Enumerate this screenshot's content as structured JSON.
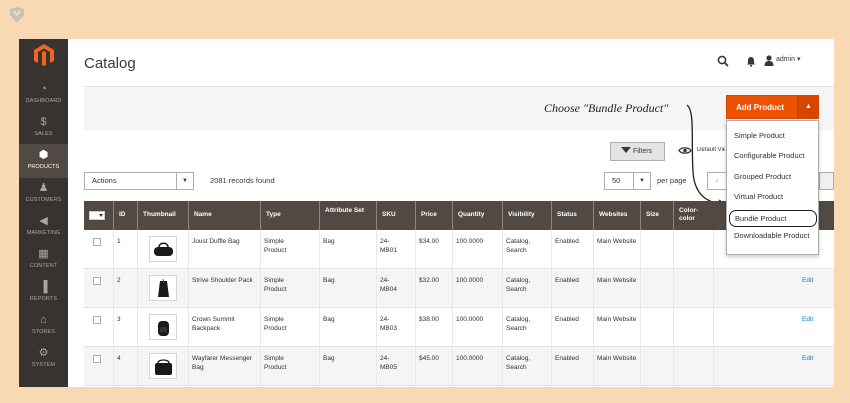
{
  "sidebar": {
    "items": [
      {
        "label": "DASHBOARD",
        "icon": "gauge-icon",
        "glyph": "◔"
      },
      {
        "label": "SALES",
        "icon": "dollar-icon",
        "glyph": "$"
      },
      {
        "label": "PRODUCTS",
        "icon": "cube-icon",
        "glyph": "⬢",
        "active": true
      },
      {
        "label": "CUSTOMERS",
        "icon": "person-icon",
        "glyph": "♟"
      },
      {
        "label": "MARKETING",
        "icon": "megaphone-icon",
        "glyph": "◀"
      },
      {
        "label": "CONTENT",
        "icon": "layout-icon",
        "glyph": "▦"
      },
      {
        "label": "REPORTS",
        "icon": "bar-chart-icon",
        "glyph": "▐"
      },
      {
        "label": "STORES",
        "icon": "store-icon",
        "glyph": "⌂"
      },
      {
        "label": "SYSTEM",
        "icon": "gear-icon",
        "glyph": "⚙"
      }
    ]
  },
  "header": {
    "title": "Catalog",
    "user": "admin ▾"
  },
  "annotation": "Choose \"Bundle Product\"",
  "add_product": {
    "label": "Add Product",
    "arrow": "▲"
  },
  "dropdown": {
    "items": [
      "Simple Product",
      "Configurable Product",
      "Grouped Product",
      "Virtual Product",
      "Bundle Product",
      "Downloadable Product"
    ],
    "selected": "Bundle Product"
  },
  "toolbar": {
    "filters": "Filters",
    "default_view": "Default View",
    "actions": "Actions",
    "records": "2081 records found",
    "per_page_value": "50",
    "per_page_label": "per page",
    "prev": "‹"
  },
  "table": {
    "columns": [
      "ID",
      "Thumbnail",
      "Name",
      "Type",
      "Attribute Set",
      "SKU",
      "Price",
      "Quantity",
      "Visibility",
      "Status",
      "Websites",
      "Size",
      "Color-color"
    ],
    "rows": [
      {
        "id": "1",
        "name": "Joust Duffle Bag",
        "type": "Simple Product",
        "attribute_set": "Bag",
        "sku": "24-MB01",
        "price": "$34.00",
        "quantity": "100.0000",
        "visibility": "Catalog, Search",
        "status": "Enabled",
        "websites": "Main Website",
        "action": ""
      },
      {
        "id": "2",
        "name": "Strive Shoulder Pack",
        "type": "Simple Product",
        "attribute_set": "Bag",
        "sku": "24-MB04",
        "price": "$32.00",
        "quantity": "100.0000",
        "visibility": "Catalog, Search",
        "status": "Enabled",
        "websites": "Main Website",
        "action": "Edit"
      },
      {
        "id": "3",
        "name": "Crown Summit Backpack",
        "type": "Simple Product",
        "attribute_set": "Bag",
        "sku": "24-MB03",
        "price": "$38.00",
        "quantity": "100.0000",
        "visibility": "Catalog, Search",
        "status": "Enabled",
        "websites": "Main Website",
        "action": "Edit"
      },
      {
        "id": "4",
        "name": "Wayfarer Messenger Bag",
        "type": "Simple Product",
        "attribute_set": "Bag",
        "sku": "24-MB05",
        "price": "$45.00",
        "quantity": "100.0000",
        "visibility": "Catalog, Search",
        "status": "Enabled",
        "websites": "Main Website",
        "action": "Edit"
      }
    ]
  },
  "colors": {
    "accent": "#eb5202",
    "sidebar": "#373330",
    "table_header": "#514943",
    "link": "#007bdb"
  }
}
